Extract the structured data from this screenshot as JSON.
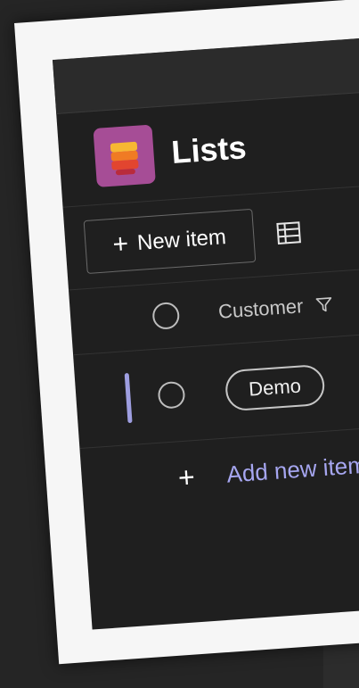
{
  "app": {
    "title": "Lists",
    "logo_colors": [
      "#a64d96",
      "#f7b733",
      "#f07b24",
      "#e2452f"
    ]
  },
  "toolbar": {
    "new_item_label": "New item",
    "view_icon": "grid-view-icon"
  },
  "columns": {
    "customer_label": "Customer",
    "filter_icon": "filter-icon"
  },
  "rows": [
    {
      "customer": "Demo"
    }
  ],
  "footer": {
    "add_label": "Add new item"
  },
  "colors": {
    "background": "#1f1f1f",
    "accent": "#a6a6f0",
    "row_indicator": "#9e9ee0"
  }
}
